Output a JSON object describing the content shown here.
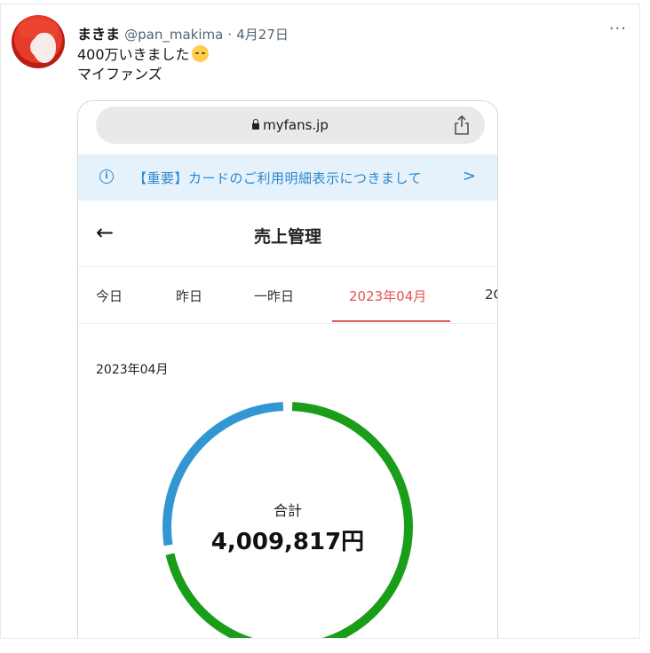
{
  "tweet": {
    "display_name": "まきま",
    "handle": "@pan_makima",
    "separator": "·",
    "date": "4月27日",
    "more_label": "···",
    "text_line1": "400万いきました",
    "emoji": "relieved-face",
    "text_line2": "マイファンズ"
  },
  "browser": {
    "url": "myfans.jp"
  },
  "notice": {
    "icon": "i",
    "text": "【重要】カードのご利用明細表示につきまして",
    "arrow": ">"
  },
  "page": {
    "back": "←",
    "title": "売上管理"
  },
  "tabs": [
    {
      "label": "今日"
    },
    {
      "label": "昨日"
    },
    {
      "label": "一昨日"
    },
    {
      "label": "2023年04月",
      "active": true
    },
    {
      "label": "2C"
    }
  ],
  "period_label": "2023年04月",
  "summary": {
    "total_label": "合計",
    "total_value": "4,009,817円"
  },
  "colors": {
    "accent_red": "#e35555",
    "donut_green": "#1a9e1a",
    "donut_blue": "#3296d2"
  },
  "chart_data": {
    "type": "pie",
    "series": [
      {
        "values": [
          0.72,
          0.28
        ]
      }
    ],
    "colors": [
      "#1a9e1a",
      "#3296d2"
    ]
  }
}
